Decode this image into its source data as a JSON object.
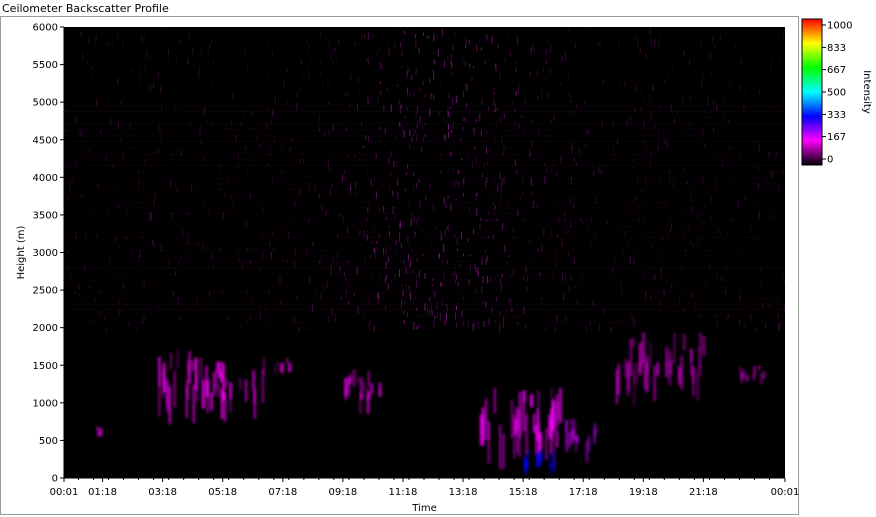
{
  "window": {
    "title": "Ceilometer Backscatter Profile"
  },
  "chart_data": {
    "type": "heatmap",
    "title": "",
    "xlabel": "Time",
    "ylabel": "Height (m)",
    "x_ticks": [
      "00:01",
      "01:18",
      "03:18",
      "05:18",
      "07:18",
      "09:18",
      "11:18",
      "13:18",
      "15:18",
      "17:18",
      "19:18",
      "21:18",
      "00:01"
    ],
    "x_tick_hours": [
      0.0167,
      1.3,
      3.3,
      5.3,
      7.3,
      9.3,
      11.3,
      13.3,
      15.3,
      17.3,
      19.3,
      21.3,
      24.0167
    ],
    "xlim_hours": [
      0.0167,
      24.0167
    ],
    "y_ticks": [
      0,
      500,
      1000,
      1500,
      2000,
      2500,
      3000,
      3500,
      4000,
      4500,
      5000,
      5500,
      6000
    ],
    "ylim": [
      0,
      6000
    ],
    "colorbar": {
      "label": "Intensity",
      "ticks": [
        0,
        167,
        333,
        500,
        667,
        833,
        1000
      ],
      "tick_labels": [
        "0",
        "167",
        "333",
        "500",
        "667",
        "833",
        "1000"
      ],
      "range": [
        0,
        1000
      ],
      "stops": [
        {
          "value": 0,
          "color": "#000000"
        },
        {
          "value": 167,
          "color": "#ff00ff"
        },
        {
          "value": 333,
          "color": "#0000ff"
        },
        {
          "value": 500,
          "color": "#00ffff"
        },
        {
          "value": 667,
          "color": "#00ff00"
        },
        {
          "value": 833,
          "color": "#ffff00"
        },
        {
          "value": 1000,
          "color": "#ff0000"
        }
      ]
    },
    "features": [
      {
        "hour_start": 1.0,
        "hour_end": 1.2,
        "height_bottom": 500,
        "height_top": 700,
        "intensity": 140
      },
      {
        "hour_start": 3.0,
        "hour_end": 4.7,
        "height_bottom": 700,
        "height_top": 1750,
        "intensity": 150
      },
      {
        "hour_start": 4.7,
        "hour_end": 6.7,
        "height_bottom": 700,
        "height_top": 1600,
        "intensity": 160
      },
      {
        "hour_start": 7.0,
        "hour_end": 7.5,
        "height_bottom": 1300,
        "height_top": 1600,
        "intensity": 140
      },
      {
        "hour_start": 9.3,
        "hour_end": 10.7,
        "height_bottom": 850,
        "height_top": 1450,
        "intensity": 150
      },
      {
        "hour_start": 13.7,
        "hour_end": 16.7,
        "height_bottom": 0,
        "height_top": 1200,
        "intensity": 170
      },
      {
        "hour_start": 15.3,
        "hour_end": 16.5,
        "height_bottom": 0,
        "height_top": 400,
        "intensity": 330
      },
      {
        "hour_start": 16.7,
        "hour_end": 17.7,
        "height_bottom": 200,
        "height_top": 800,
        "intensity": 200
      },
      {
        "hour_start": 18.3,
        "hour_end": 21.3,
        "height_bottom": 950,
        "height_top": 1950,
        "intensity": 130
      },
      {
        "hour_start": 22.5,
        "hour_end": 23.3,
        "height_bottom": 1200,
        "height_top": 1500,
        "intensity": 130
      }
    ]
  }
}
